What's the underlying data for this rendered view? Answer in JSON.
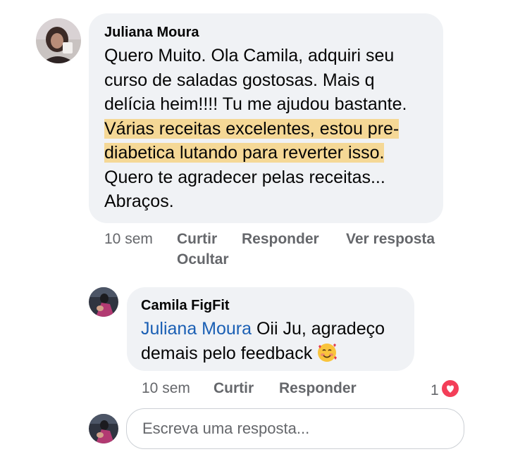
{
  "comment": {
    "author": "Juliana Moura",
    "lines": [
      "Quero Muito. Ola Camila, adquiri seu",
      "curso de saladas gostosas. Mais q",
      "delícia heim!!!! Tu me ajudou bastante.",
      "Várias receitas excelentes, estou pre-",
      "diabetica lutando para reverter isso.",
      "Quero te agradecer pelas receitas...",
      "Abraços."
    ],
    "time": "10 sem",
    "like_label": "Curtir",
    "reply_label": "Responder",
    "view_reply_label": "Ver resposta",
    "hide_label": "Ocultar"
  },
  "reply": {
    "author": "Camila FigFit",
    "mention": "Juliana Moura",
    "line1_rest": " Oii Ju, agradeço",
    "line2": "demais pelo feedback",
    "emoji": "smiling-face-with-hearts",
    "time": "10 sem",
    "like_label": "Curtir",
    "reply_label": "Responder",
    "reaction_count": "1"
  },
  "composer": {
    "placeholder": "Escreva uma resposta..."
  },
  "colors": {
    "bubble": "#f0f2f5",
    "highlight": "#f5d896",
    "mention": "#1a5fb4",
    "meta": "#65676b",
    "heart": "#f33e58"
  }
}
